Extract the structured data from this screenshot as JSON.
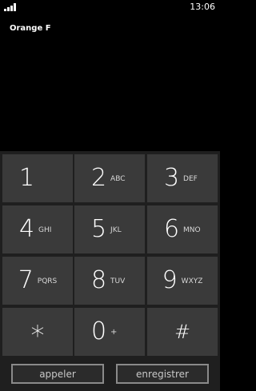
{
  "status": {
    "time": "13:06",
    "signal_icon": "signal-strength-icon"
  },
  "carrier": "Orange F",
  "keypad": {
    "keys": [
      {
        "digit": "1",
        "letters": ""
      },
      {
        "digit": "2",
        "letters": "ABC"
      },
      {
        "digit": "3",
        "letters": "DEF"
      },
      {
        "digit": "4",
        "letters": "GHI"
      },
      {
        "digit": "5",
        "letters": "JKL"
      },
      {
        "digit": "6",
        "letters": "MNO"
      },
      {
        "digit": "7",
        "letters": "PQRS"
      },
      {
        "digit": "8",
        "letters": "TUV"
      },
      {
        "digit": "9",
        "letters": "WXYZ"
      },
      {
        "digit": "*",
        "letters": ""
      },
      {
        "digit": "0",
        "letters": "+"
      },
      {
        "digit": "#",
        "letters": ""
      }
    ]
  },
  "actions": {
    "call_label": "appeler",
    "save_label": "enregistrer"
  },
  "colors": {
    "background": "#000000",
    "key": "#3a3a3a",
    "keypad_bg": "#1f1f1f"
  }
}
